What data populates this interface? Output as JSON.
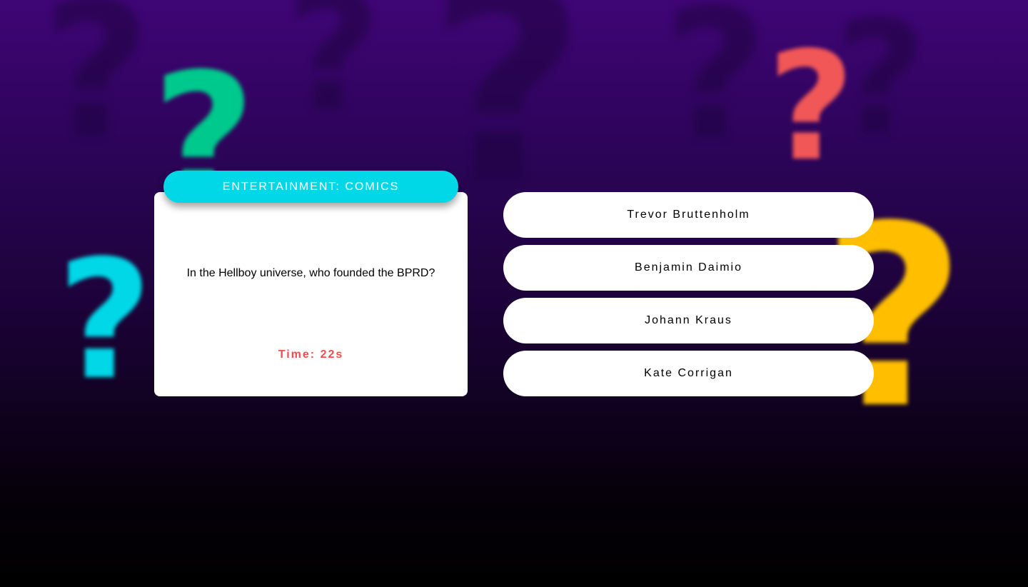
{
  "background": {
    "decor_glyph": "?",
    "colors": {
      "green": "#00c98d",
      "cyan": "#00d8e8",
      "coral": "#f25757",
      "yellow": "#ffbf00",
      "gradient_top": "#3f0575",
      "gradient_bottom": "#000000"
    }
  },
  "quiz": {
    "category": "ENTERTAINMENT: COMICS",
    "question": "In the Hellboy universe, who founded the BPRD?",
    "timer": "Time: 22s",
    "answers": [
      {
        "label": "Trevor Bruttenholm"
      },
      {
        "label": "Benjamin Daimio"
      },
      {
        "label": "Johann Kraus"
      },
      {
        "label": "Kate Corrigan"
      }
    ],
    "colors": {
      "category_bg": "#00d8e8",
      "timer_text": "#f24c4c",
      "card_bg": "#ffffff"
    }
  }
}
